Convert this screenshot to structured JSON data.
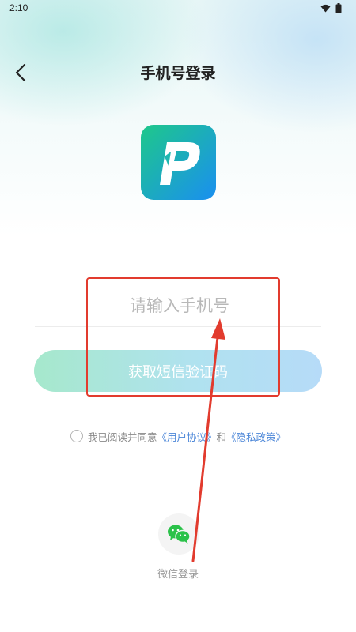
{
  "status_bar": {
    "time": "2:10",
    "icons": [
      "wifi-icon",
      "battery-icon"
    ]
  },
  "header": {
    "title": "手机号登录",
    "back_icon": "chevron-left-icon"
  },
  "logo": {
    "letter": "P",
    "colors": [
      "#1ec88a",
      "#1a8ff0"
    ]
  },
  "phone_input": {
    "value": "",
    "placeholder": "请输入手机号"
  },
  "sms_button": {
    "label": "获取短信验证码"
  },
  "agreement": {
    "prefix": "我已阅读并同意",
    "user_agreement": "《用户协议》",
    "and": "和",
    "privacy_policy": "《隐私政策》"
  },
  "wechat": {
    "label": "微信登录",
    "icon": "wechat-icon",
    "color": "#2bc24a"
  },
  "annotation": {
    "color": "#e23b2e"
  }
}
